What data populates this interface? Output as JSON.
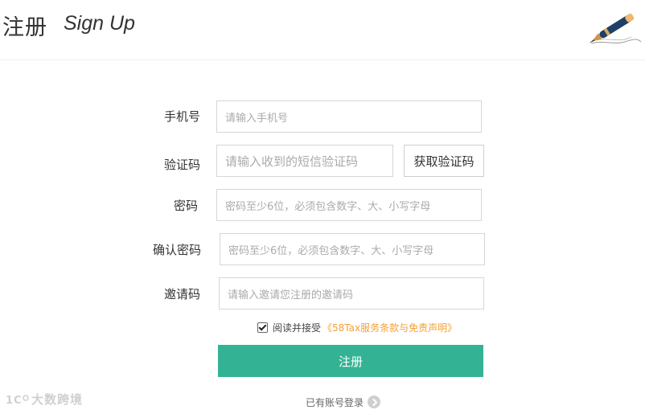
{
  "header": {
    "title_cn": "注册",
    "title_en": "Sign Up"
  },
  "form": {
    "phone": {
      "label": "手机号",
      "placeholder": "请输入手机号"
    },
    "code": {
      "label": "验证码",
      "placeholder": "请输入收到的短信验证码",
      "button": "获取验证码"
    },
    "password": {
      "label": "密码",
      "placeholder": "密码至少6位，必须包含数字、大、小写字母"
    },
    "confirm": {
      "label": "确认密码",
      "placeholder": "密码至少6位，必须包含数字、大、小写字母"
    },
    "invite": {
      "label": "邀请码",
      "placeholder": "请输入邀请您注册的邀请码"
    },
    "agreement": {
      "checked": true,
      "text": "阅读并接受",
      "link": "《58Tax服务条款与免责声明》"
    },
    "submit_label": "注册",
    "login_text": "已有账号登录"
  },
  "watermark": {
    "text": "大数跨境"
  },
  "colors": {
    "primary": "#34b394",
    "link": "#f5a032"
  },
  "icons": {
    "pen": "fountain-pen-icon",
    "arrow": "chevron-right-icon"
  }
}
